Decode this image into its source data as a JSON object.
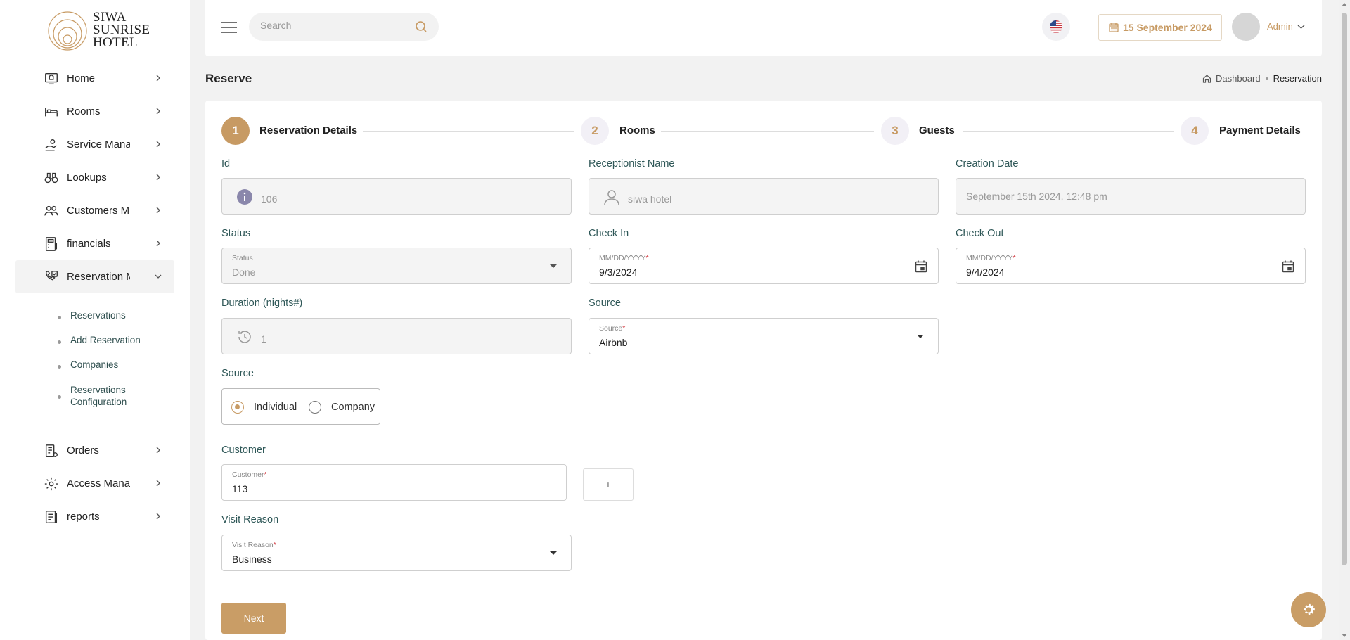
{
  "brand": {
    "line1": "SIWA",
    "line2": "SUNRISE",
    "line3": "HOTEL"
  },
  "sidebar": {
    "items": [
      {
        "label": "Home",
        "icon": "home-icon"
      },
      {
        "label": "Rooms",
        "icon": "bed-icon"
      },
      {
        "label": "Service Mana",
        "icon": "service-hand-icon"
      },
      {
        "label": "Lookups",
        "icon": "binoculars-icon"
      },
      {
        "label": "Customers M",
        "icon": "customers-icon"
      },
      {
        "label": "financials",
        "icon": "calculator-icon"
      },
      {
        "label": "Reservation M",
        "icon": "reservation-icon"
      },
      {
        "label": "Orders",
        "icon": "orders-icon"
      },
      {
        "label": "Access Manag",
        "icon": "access-gear-icon"
      },
      {
        "label": "reports",
        "icon": "reports-icon"
      }
    ],
    "subitems": [
      "Reservations",
      "Add Reservation",
      "Companies",
      "Reservations Configuration"
    ]
  },
  "topbar": {
    "search_placeholder": "Search",
    "date": "15 September 2024",
    "user": "Admin"
  },
  "page": {
    "title": "Reserve",
    "breadcrumb": {
      "root": "Dashboard",
      "current": "Reservation"
    }
  },
  "steps": [
    {
      "num": "1",
      "label": "Reservation Details"
    },
    {
      "num": "2",
      "label": "Rooms"
    },
    {
      "num": "3",
      "label": "Guests"
    },
    {
      "num": "4",
      "label": "Payment Details"
    }
  ],
  "form": {
    "id": {
      "label": "Id",
      "value": "106"
    },
    "receptionist": {
      "label": "Receptionist Name",
      "value": "siwa hotel"
    },
    "creation": {
      "label": "Creation Date",
      "value": "September 15th 2024, 12:48 pm"
    },
    "status": {
      "label": "Status",
      "small": "Status",
      "value": "Done"
    },
    "checkin": {
      "label": "Check In",
      "small": "MM/DD/YYYY",
      "value": "9/3/2024"
    },
    "checkout": {
      "label": "Check Out",
      "small": "MM/DD/YYYY",
      "value": "9/4/2024"
    },
    "duration": {
      "label": "Duration (nights#)",
      "value": "1"
    },
    "source": {
      "label": "Source",
      "small": "Source",
      "value": "Airbnb"
    },
    "source_type": {
      "label": "Source",
      "options": [
        "Individual",
        "Company"
      ],
      "selected": "Individual"
    },
    "customer": {
      "label": "Customer",
      "small": "Customer",
      "value": "113",
      "add_label": "+"
    },
    "visit_reason": {
      "label": "Visit Reason",
      "small": "Visit Reason",
      "value": "Business"
    },
    "required_mark": "*",
    "next_label": "Next"
  },
  "colors": {
    "accent": "#c79a63",
    "button": "#c99d66",
    "label": "#2e5757"
  }
}
